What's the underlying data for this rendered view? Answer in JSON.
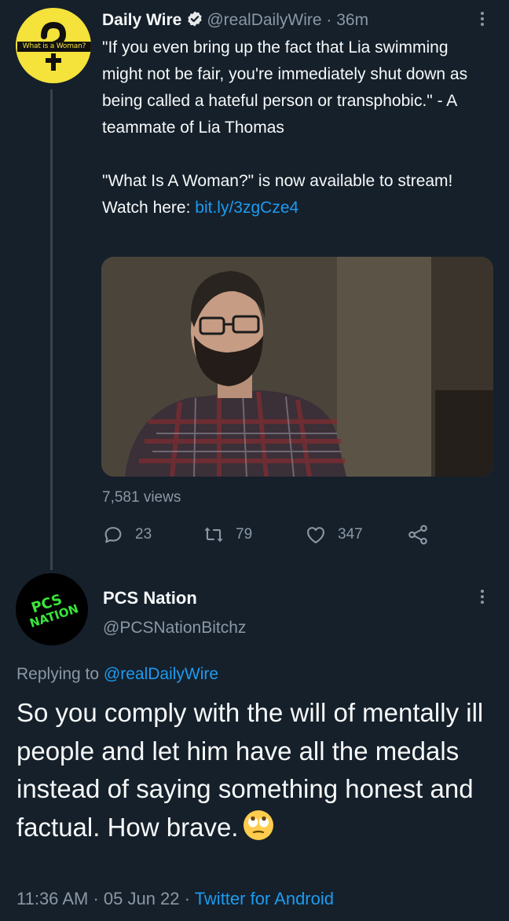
{
  "parent_tweet": {
    "avatar_text": "What is a Woman?",
    "display_name": "Daily Wire",
    "handle": "@realDailyWire",
    "separator": "·",
    "time": "36m",
    "text_paragraph_1": "\"If you even bring up the fact that Lia swimming might not be fair, you're immediately shut down as being called a hateful person or transphobic.\" - A teammate of Lia Thomas",
    "text_paragraph_2": "\"What Is A Woman?\" is now available to stream! Watch here: ",
    "link_text": "bit.ly/3zgCze4",
    "views": "7,581 views",
    "replies": "23",
    "retweets": "79",
    "likes": "347"
  },
  "reply_tweet": {
    "avatar_text_line1": "PCS",
    "avatar_text_line2": "NATION",
    "display_name": "PCS Nation",
    "handle": "@PCSNationBitchz",
    "replying_prefix": "Replying to ",
    "replying_to": "@realDailyWire",
    "text": "So you comply with the will of mentally ill people and let him have all the medals instead of saying something honest and factual. How brave.",
    "emoji": "face-with-rolling-eyes",
    "time": "11:36 AM",
    "sep1": " · ",
    "date": "05 Jun 22",
    "sep2": " · ",
    "source": "Twitter for Android"
  },
  "colors": {
    "background": "#15202b",
    "text": "#f7f9f9",
    "muted": "#8b98a5",
    "link": "#1d9bf0",
    "logo_yellow": "#f5e23a",
    "pcs_green": "#39e639"
  },
  "icons": [
    "verified-badge-icon",
    "more-icon",
    "reply-icon",
    "retweet-icon",
    "like-icon",
    "share-icon"
  ]
}
